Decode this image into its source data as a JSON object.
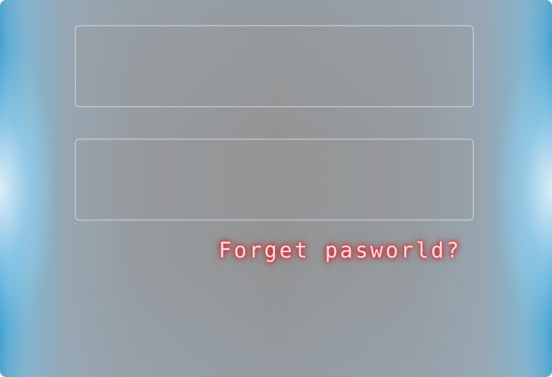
{
  "login": {
    "username_field": {
      "value": "",
      "placeholder": ""
    },
    "password_field": {
      "value": "",
      "placeholder": ""
    },
    "forgot_password_link": "Forget pasworld?"
  },
  "colors": {
    "edge_glow": "#2c9fda",
    "panel_background": "#949494",
    "field_border": "#e1e6eb",
    "link_text": "#fde8e8",
    "link_glow": "#d8262e"
  }
}
